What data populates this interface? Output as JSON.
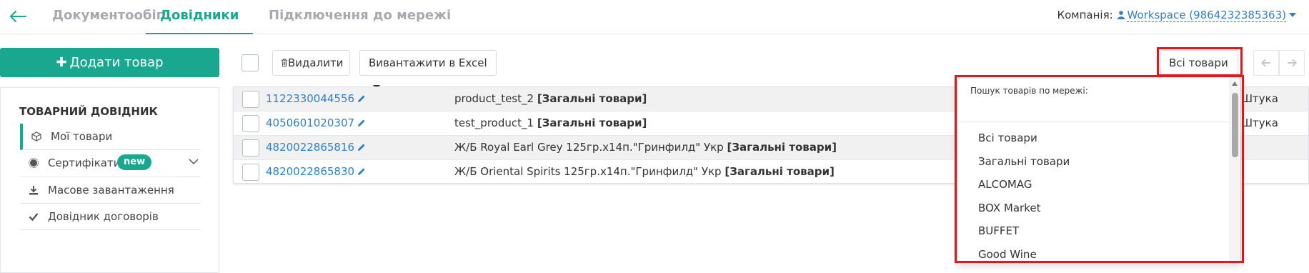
{
  "nav": {
    "tabs": [
      {
        "label": "Документообіг",
        "active": false
      },
      {
        "label": "Довідники",
        "active": true
      },
      {
        "label": "Підключення до мережі",
        "active": false
      }
    ],
    "company_label": "Компанія:",
    "company_value": "Workspace (9864232385363)"
  },
  "sidebar": {
    "add_button": "Додати товар",
    "title": "ТОВАРНИЙ ДОВІДНИК",
    "items": [
      {
        "label": "Мої товари",
        "icon": "cube-icon",
        "active": true
      },
      {
        "label": "Сертифікати",
        "icon": "certificate-icon",
        "badge": "new"
      },
      {
        "label": "Масове завантаження",
        "icon": "download-icon"
      },
      {
        "label": "Довідник договорів",
        "icon": "check-icon"
      }
    ]
  },
  "toolbar": {
    "delete_label": "Видалити",
    "export_label": "Вивантажити в Excel",
    "filter_label": "Всі товари"
  },
  "table": {
    "rows": [
      {
        "code": "1122330044556",
        "name": "product_test_2",
        "group": "[Загальні товари]",
        "unit": "Штука"
      },
      {
        "code": "4050601020307",
        "name": "test_product_1",
        "group": "[Загальні товари]",
        "unit": "Штука"
      },
      {
        "code": "4820022865816",
        "name": "Ж/Б Royal Earl Grey 125гр.x14п.\"Гринфилд\" Укр",
        "group": "[Загальні товари]",
        "unit": ""
      },
      {
        "code": "4820022865830",
        "name": "Ж/Б Oriental Spirits 125гр.x14п.\"Гринфилд\" Укр",
        "group": "[Загальні товари]",
        "unit": ""
      }
    ]
  },
  "dropdown": {
    "search_label": "Пошук товарів по мережі:",
    "search_value": "",
    "options": [
      "Всі товари",
      "Загальні товари",
      "ALCOMAG",
      "BOX Market",
      "BUFFET",
      "Good Wine"
    ]
  },
  "colors": {
    "accent": "#1aa78f",
    "link": "#2f7fc4",
    "highlight": "#e8141b"
  }
}
